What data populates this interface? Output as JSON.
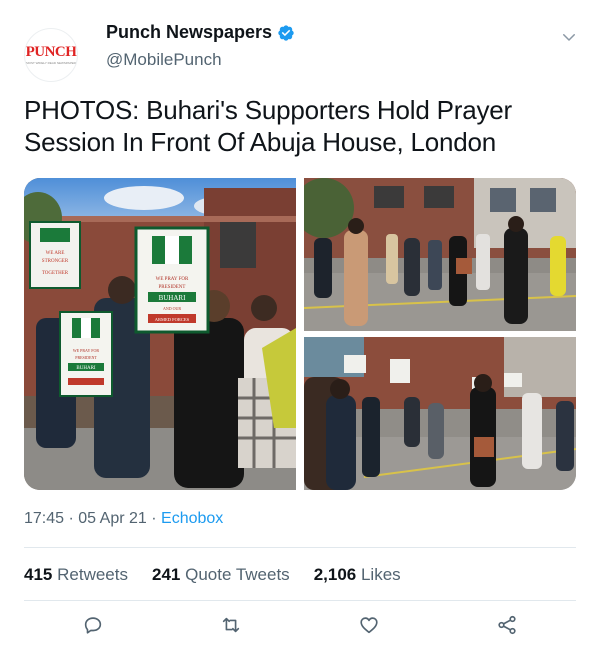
{
  "account": {
    "display_name": "Punch Newspapers",
    "handle": "@MobilePunch",
    "avatar_logo_text": "PUNCH",
    "avatar_tagline": "MOST WIDELY READ NEWSPAPER",
    "verified": true
  },
  "tweet": {
    "text": "PHOTOS: Buhari's Supporters Hold Prayer Session In Front Of Abuja House, London",
    "time": "17:45",
    "date": "05 Apr 21",
    "separator": "·",
    "source": "Echobox"
  },
  "media": {
    "photos": [
      {
        "name": "photo-supporters-with-placards",
        "signs": {
          "placard_left": "WE ARE STRONGER TOGETHER",
          "placard_center": "WE PRAY FOR PRESIDENT BUHARI AND OUR ARMED FORCES",
          "placard_low": "WE PRAY FOR PRESIDENT BUHARI AND OUR ARMED FORCES"
        }
      },
      {
        "name": "photo-street-crowd-1"
      },
      {
        "name": "photo-street-crowd-2"
      }
    ]
  },
  "stats": {
    "retweets_count": "415",
    "retweets_label": "Retweets",
    "quotes_count": "241",
    "quotes_label": "Quote Tweets",
    "likes_count": "2,106",
    "likes_label": "Likes"
  },
  "icons": {
    "reply": "reply-icon",
    "retweet": "retweet-icon",
    "like": "heart-icon",
    "share": "share-icon",
    "more": "chevron-down-icon",
    "verified": "verified-badge-icon"
  },
  "colors": {
    "accent": "#1d9bf0",
    "text": "#0f1419",
    "secondary": "#536471",
    "brand_red": "#e02424"
  }
}
